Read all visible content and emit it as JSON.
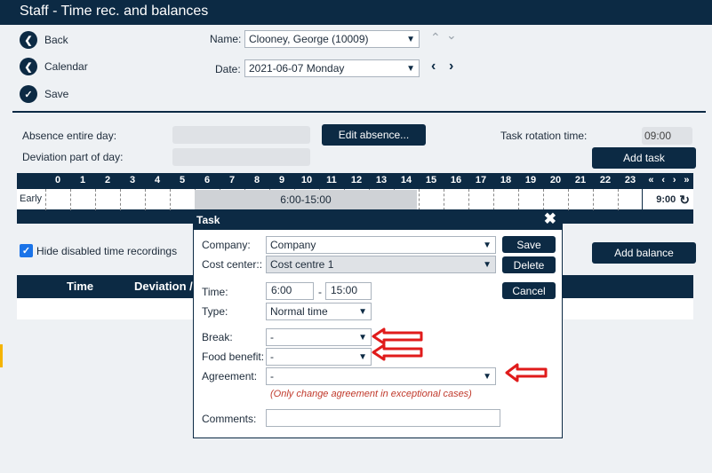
{
  "title": "Staff - Time rec. and balances",
  "nav": {
    "back": "Back",
    "calendar": "Calendar",
    "save": "Save"
  },
  "name": {
    "label": "Name:",
    "value": "Clooney, George (10009)"
  },
  "date": {
    "label": "Date:",
    "value": "2021-06-07 Monday"
  },
  "absence": {
    "entire_day": "Absence entire day:",
    "deviation": "Deviation part of day:",
    "edit_button": "Edit absence..."
  },
  "task_rotation": {
    "label": "Task rotation time:",
    "value": "09:00"
  },
  "add_task": "Add task",
  "timeline": {
    "hours": [
      "0",
      "1",
      "2",
      "3",
      "4",
      "5",
      "6",
      "7",
      "8",
      "9",
      "10",
      "11",
      "12",
      "13",
      "14",
      "15",
      "16",
      "17",
      "18",
      "19",
      "20",
      "21",
      "22",
      "23"
    ],
    "row_label": "Early",
    "shift": "6:00-15:00",
    "time_now": "9:00",
    "shift_start_hour": 6,
    "shift_end_hour": 15,
    "nav_glyphs": [
      "«",
      "‹",
      "›",
      "»"
    ]
  },
  "hide_disabled": {
    "label": "Hide disabled time recordings",
    "checked": true
  },
  "add_balance": "Add balance",
  "table": {
    "columns": [
      "Time",
      "Deviation /"
    ]
  },
  "dialog": {
    "title": "Task",
    "company": {
      "label": "Company:",
      "value": "Company"
    },
    "cost_center": {
      "label": "Cost center::",
      "value": "Cost centre 1"
    },
    "time": {
      "label": "Time:",
      "from": "6:00",
      "sep": "-",
      "to": "15:00"
    },
    "type": {
      "label": "Type:",
      "value": "Normal time"
    },
    "break": {
      "label": "Break:",
      "value": "-"
    },
    "food": {
      "label": "Food benefit:",
      "value": "-"
    },
    "agreement": {
      "label": "Agreement:",
      "value": "-"
    },
    "agreement_note": "(Only change agreement in exceptional cases)",
    "comments": {
      "label": "Comments:",
      "value": ""
    },
    "buttons": {
      "save": "Save",
      "delete": "Delete",
      "cancel": "Cancel"
    },
    "close_icon": "✖"
  },
  "colors": {
    "navy": "#0c2a44",
    "arrow_red": "#e01b1b",
    "note_red": "#c0392b"
  }
}
